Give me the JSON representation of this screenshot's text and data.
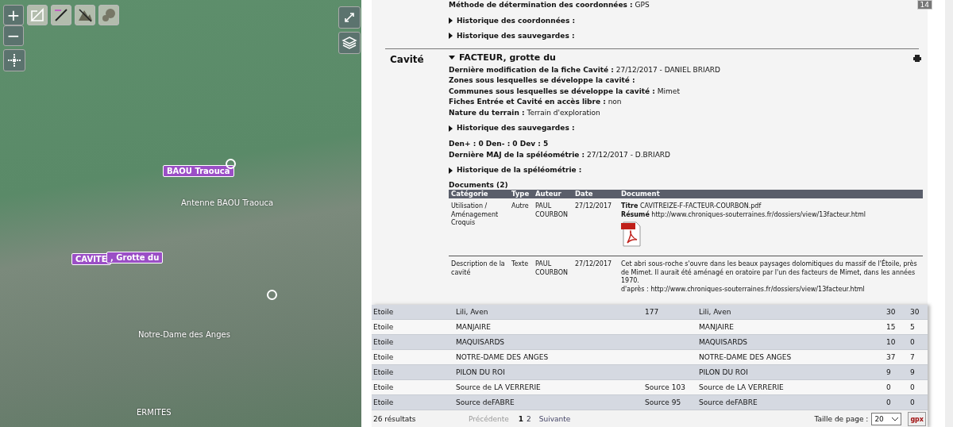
{
  "map": {
    "markers": [
      {
        "kind": "tag",
        "label": "BAOU Traouca"
      },
      {
        "kind": "tag",
        "label": "CAVITE"
      },
      {
        "kind": "tag",
        "label": ", Grotte du"
      },
      {
        "kind": "plain",
        "label": "Antenne BAOU Traouca"
      },
      {
        "kind": "plain",
        "label": "Notre-Dame des Anges"
      },
      {
        "kind": "plain",
        "label": "ERMITES"
      },
      {
        "kind": "ring"
      },
      {
        "kind": "ring"
      }
    ],
    "zoom_in": "+",
    "zoom_out": "−"
  },
  "corner_badge": "14",
  "details": {
    "top_blocks": [
      {
        "kind": "field",
        "label": "Méthode de détermination des coordonnées :",
        "value": "GPS"
      },
      {
        "kind": "expander",
        "label": "Historique des coordonnées :",
        "expanded": false
      },
      {
        "kind": "expander",
        "label": "Historique des sauvegardes :",
        "expanded": false
      }
    ],
    "section": {
      "heading": "Cavité",
      "title": "FACTEUR, grotte du",
      "expanded": true,
      "blocks": [
        {
          "kind": "field",
          "label": "Dernière modification de la fiche Cavité :",
          "value": "27/12/2017 - DANIEL BRIARD"
        },
        {
          "kind": "field",
          "label": "Zones sous lesquelles se développe la cavité :"
        },
        {
          "kind": "field",
          "label": "Communes sous lesquelles se développe la cavité :",
          "value": "Mimet"
        },
        {
          "kind": "field",
          "label": "Fiches Entrée et Cavité en accès libre :",
          "value": "non"
        },
        {
          "kind": "field",
          "label": "Nature du terrain :",
          "value": "Terrain d'exploration"
        },
        {
          "kind": "expander",
          "label": "Historique des sauvegardes :",
          "expanded": false
        },
        {
          "kind": "field",
          "label": "Den+ : 0 Den- : 0 Dev : 5"
        },
        {
          "kind": "field",
          "label": "Dernière MAJ de la spéléométrie :",
          "value": "27/12/2017 - D.BRIARD"
        },
        {
          "kind": "expander",
          "label": "Historique de la spéléométrie :",
          "expanded": false
        }
      ],
      "documents": {
        "title": "Documents (2)",
        "columns": [
          "Catégorie",
          "Type",
          "Auteur",
          "Date",
          "Document"
        ],
        "rows": [
          {
            "category": "Utilisation / Aménagement Croquis",
            "type": "Autre",
            "author": "PAUL COURBON",
            "date": "27/12/2017",
            "lines": [
              "**Titre** CAVITREIZE-F-FACTEUR-COURBON.pdf",
              "**Résumé** http://www.chroniques-souterraines.fr/dossiers/view/13facteur.html"
            ],
            "has_pdf": true
          },
          {
            "category": "Description de la cavité",
            "type": "Texte",
            "author": "PAUL COURBON",
            "date": "27/12/2017",
            "lines": [
              "Cet abri sous-roche s'ouvre dans les beaux paysages dolomitiques du massif de l'Étoile, près de Mimet. Il aurait été aménagé en oratoire par l'un des facteurs de Mimet, dans les années 1970.",
              "d'après : http://www.chroniques-souterraines.fr/dossiers/view/13facteur.html"
            ],
            "has_pdf": false
          }
        ]
      }
    }
  },
  "results": {
    "rows": [
      {
        "cells": [
          "Etoile",
          "Lili, Aven",
          "177",
          "Lili, Aven",
          "30",
          "30"
        ]
      },
      {
        "cells": [
          "Etoile",
          "MANJAIRE",
          "",
          "MANJAIRE",
          "15",
          "5"
        ]
      },
      {
        "cells": [
          "Etoile",
          "MAQUISARDS",
          "",
          "MAQUISARDS",
          "10",
          "0"
        ]
      },
      {
        "cells": [
          "Etoile",
          "NOTRE-DAME DES ANGES",
          "",
          "NOTRE-DAME DES ANGES",
          "37",
          "7"
        ]
      },
      {
        "cells": [
          "Etoile",
          "PILON DU ROI",
          "",
          "PILON DU ROI",
          "9",
          "9"
        ]
      },
      {
        "cells": [
          "Etoile",
          "Source de LA VERRERIE",
          "Source 103",
          "Source de LA VERRERIE",
          "0",
          "0"
        ]
      },
      {
        "cells": [
          "Etoile",
          "Source deFABRE",
          "Source 95",
          "Source deFABRE",
          "0",
          "0"
        ]
      }
    ]
  },
  "pagination": {
    "count": "26 résultats",
    "prev": {
      "label": "Précédente",
      "disabled": true
    },
    "pages": [
      {
        "label": "1",
        "selected": true
      },
      {
        "label": "2",
        "selected": false
      }
    ],
    "next": {
      "label": "Suivante",
      "disabled": false
    },
    "page_size_label": "Taille de page :",
    "page_size": "20",
    "export_label": "gpx"
  }
}
